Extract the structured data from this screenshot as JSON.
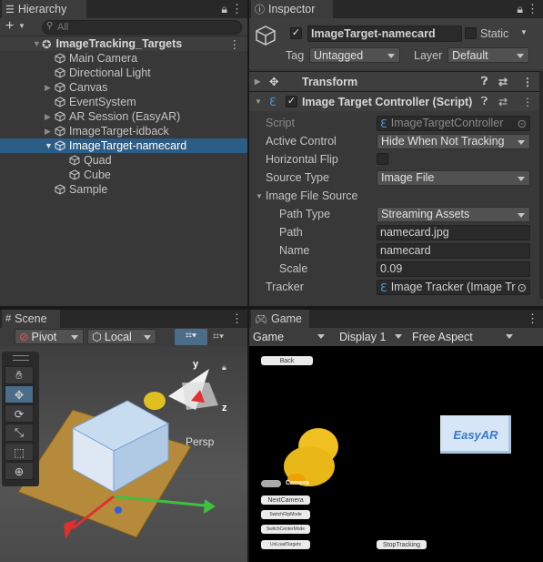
{
  "hierarchy": {
    "tab": "Hierarchy",
    "search_placeholder": "All",
    "add_label": "+",
    "scene_name": "ImageTracking_Targets",
    "items": [
      {
        "label": "Main Camera"
      },
      {
        "label": "Directional Light"
      },
      {
        "label": "Canvas"
      },
      {
        "label": "EventSystem"
      },
      {
        "label": "AR Session (EasyAR)"
      },
      {
        "label": "ImageTarget-idback"
      },
      {
        "label": "ImageTarget-namecard"
      },
      {
        "label": "Quad"
      },
      {
        "label": "Cube"
      },
      {
        "label": "Sample"
      }
    ]
  },
  "inspector": {
    "tab": "Inspector",
    "object_name": "ImageTarget-namecard",
    "static_label": "Static",
    "tag_label": "Tag",
    "tag_value": "Untagged",
    "layer_label": "Layer",
    "layer_value": "Default",
    "transform_label": "Transform",
    "component_label": "Image Target Controller (Script)",
    "fields": {
      "script_label": "Script",
      "script_value": "ImageTargetController",
      "active_control_label": "Active Control",
      "active_control_value": "Hide When Not Tracking",
      "horizontal_flip_label": "Horizontal Flip",
      "source_type_label": "Source Type",
      "source_type_value": "Image File",
      "image_file_source_label": "Image File Source",
      "path_type_label": "Path Type",
      "path_type_value": "Streaming Assets",
      "path_label": "Path",
      "path_value": "namecard.jpg",
      "name_label": "Name",
      "name_value": "namecard",
      "scale_label": "Scale",
      "scale_value": "0.09",
      "tracker_label": "Tracker",
      "tracker_value": "Image Tracker (Image Tr"
    }
  },
  "scene": {
    "tab": "Scene",
    "pivot_label": "Pivot",
    "local_label": "Local",
    "persp_label": "Persp",
    "axis_y": "y",
    "axis_z": "z"
  },
  "game": {
    "tab": "Game",
    "mode": "Game",
    "display": "Display 1",
    "aspect": "Free Aspect",
    "card_text": "EasyAR",
    "buttons": {
      "back": "Back",
      "camera": "Camera",
      "next_camera": "NextCamera",
      "switch_flip": "SwitchFlipMode",
      "switch_center": "SwitchCenterMode",
      "unload": "UnLoadTargets",
      "stop": "StopTracking"
    }
  },
  "colors": {
    "selection": "#2c5d87",
    "panel": "#383838",
    "accent_blue": "#4b9cdc"
  }
}
